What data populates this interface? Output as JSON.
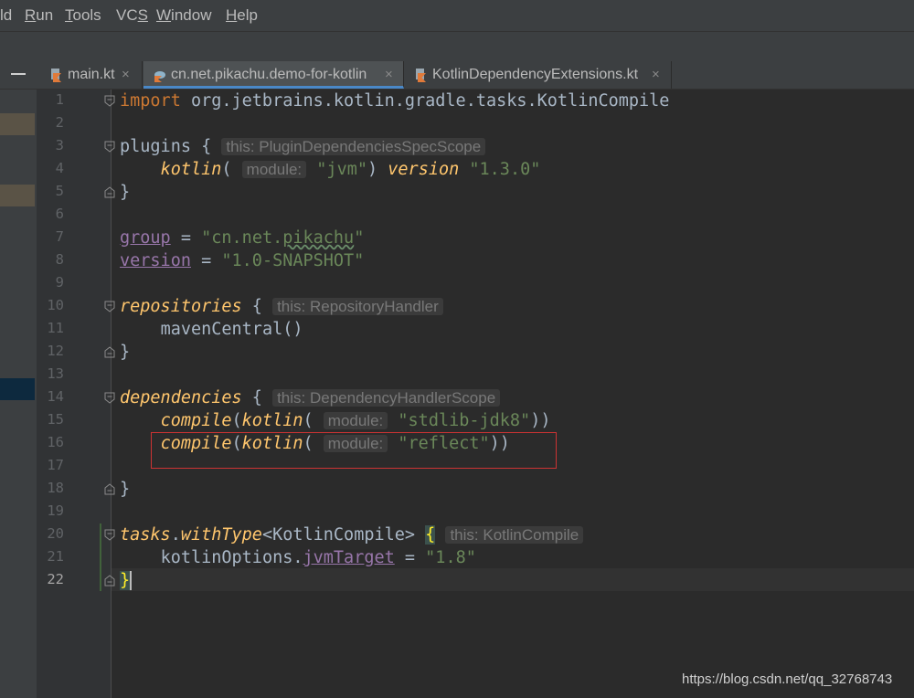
{
  "menu": {
    "items": [
      {
        "pre": "",
        "mn": "",
        "post": "ld"
      },
      {
        "pre": "",
        "mn": "R",
        "post": "un"
      },
      {
        "pre": "",
        "mn": "T",
        "post": "ools"
      },
      {
        "pre": "VC",
        "mn": "S",
        "post": ""
      },
      {
        "pre": "",
        "mn": "W",
        "post": "indow"
      },
      {
        "pre": "",
        "mn": "H",
        "post": "elp"
      }
    ]
  },
  "tabs": [
    {
      "label": "main.kt",
      "close": "×",
      "icon": "kotlin-file-icon",
      "active": false
    },
    {
      "label": "cn.net.pikachu.demo-for-kotlin",
      "close": "×",
      "icon": "gradle-kotlin-file-icon",
      "active": true
    },
    {
      "label": "KotlinDependencyExtensions.kt",
      "close": "×",
      "icon": "kotlin-file-icon",
      "active": false
    }
  ],
  "editor": {
    "line_numbers": [
      "1",
      "2",
      "3",
      "4",
      "5",
      "6",
      "7",
      "8",
      "9",
      "10",
      "11",
      "12",
      "13",
      "14",
      "15",
      "16",
      "17",
      "18",
      "19",
      "20",
      "21",
      "22"
    ],
    "current_line": "22",
    "lines": {
      "l1": {
        "kw": "import",
        "rest": " org.jetbrains.kotlin.gradle.tasks.KotlinCompile"
      },
      "l3": {
        "name": "plugins",
        "brace": " { ",
        "hint_text": "this: PluginDependenciesSpecScope"
      },
      "l4": {
        "indent": "    ",
        "fn": "kotlin",
        "open": "( ",
        "hint_text": "module:",
        "str": "\"jvm\"",
        "close": ") ",
        "fn2": "version",
        "sp": " ",
        "str2": "\"1.3.0\""
      },
      "l5": {
        "brace": "}"
      },
      "l7": {
        "prop": "group",
        "eq": " = ",
        "q1": "\"cn.net.",
        "wavy": "pikachu",
        "q2": "\""
      },
      "l8": {
        "prop": "version",
        "eq": " = ",
        "str": "\"1.0-SNAPSHOT\""
      },
      "l10": {
        "fn": "repositories",
        "brace": " { ",
        "hint_text": "this: RepositoryHandler"
      },
      "l11": {
        "indent": "    ",
        "text": "mavenCentral()"
      },
      "l12": {
        "brace": "}"
      },
      "l14": {
        "fn": "dependencies",
        "brace": " { ",
        "hint_text": "this: DependencyHandlerScope"
      },
      "l15": {
        "indent": "    ",
        "fn": "compile",
        "open": "(",
        "fn2": "kotlin",
        "open2": "( ",
        "hint_text": "module:",
        "str": "\"stdlib-jdk8\"",
        "close": "))"
      },
      "l16": {
        "indent": "    ",
        "fn": "compile",
        "open": "(",
        "fn2": "kotlin",
        "open2": "( ",
        "hint_text": "module:",
        "str": "\"reflect\"",
        "close": "))"
      },
      "l18": {
        "brace": "}"
      },
      "l20": {
        "fn": "tasks",
        "dot": ".",
        "fn2": "withType",
        "generic": "<KotlinCompile> ",
        "brace": "{",
        "hint_text": "this: KotlinCompile"
      },
      "l21": {
        "indent": "    ",
        "text": "kotlinOptions.",
        "prop": "jvmTarget",
        "eq": " = ",
        "str": "\"1.8\""
      },
      "l22": {
        "brace": "}"
      }
    }
  },
  "watermark": "https://blog.csdn.net/qq_32768743",
  "colors": {
    "background": "#2b2b2b",
    "keyword": "#cc7832",
    "function": "#ffc66d",
    "string": "#6a8759",
    "property": "#9876aa",
    "plain": "#a9b7c6",
    "highlight_box": "#cc3333",
    "active_tab_underline": "#4a88c7"
  }
}
